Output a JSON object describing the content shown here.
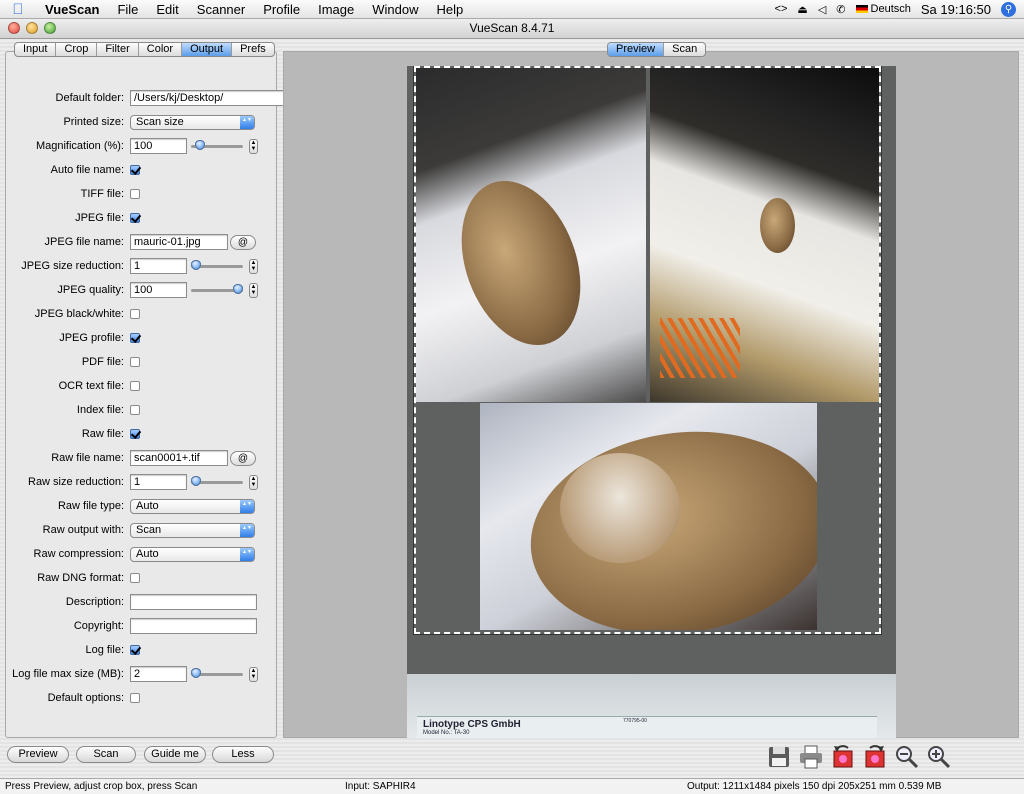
{
  "menubar": {
    "app": "VueScan",
    "items": [
      "File",
      "Edit",
      "Scanner",
      "Profile",
      "Image",
      "Window",
      "Help"
    ],
    "language": "Deutsch",
    "clock": "Sa 19:16:50",
    "status_icons": [
      "code-icon",
      "eject-icon",
      "volume-icon",
      "phone-icon"
    ]
  },
  "window": {
    "title": "VueScan 8.4.71"
  },
  "left_tabs": [
    {
      "label": "Input",
      "active": false
    },
    {
      "label": "Crop",
      "active": false
    },
    {
      "label": "Filter",
      "active": false
    },
    {
      "label": "Color",
      "active": false
    },
    {
      "label": "Output",
      "active": true
    },
    {
      "label": "Prefs",
      "active": false
    }
  ],
  "right_tabs": [
    {
      "label": "Preview",
      "active": true
    },
    {
      "label": "Scan",
      "active": false
    }
  ],
  "output": {
    "default_folder": {
      "label": "Default folder:",
      "value": "/Users/kj/Desktop/",
      "button": "@"
    },
    "printed_size": {
      "label": "Printed size:",
      "value": "Scan size"
    },
    "magnification": {
      "label": "Magnification (%):",
      "value": "100",
      "slider": 0.1
    },
    "auto_file_name": {
      "label": "Auto file name:",
      "checked": true
    },
    "tiff_file": {
      "label": "TIFF file:",
      "checked": false
    },
    "jpeg_file": {
      "label": "JPEG file:",
      "checked": true
    },
    "jpeg_file_name": {
      "label": "JPEG file name:",
      "value": "mauric-01.jpg",
      "button": "@"
    },
    "jpeg_size_reduction": {
      "label": "JPEG size reduction:",
      "value": "1",
      "slider": 0.0
    },
    "jpeg_quality": {
      "label": "JPEG quality:",
      "value": "100",
      "slider": 1.0
    },
    "jpeg_black_white": {
      "label": "JPEG black/white:",
      "checked": false
    },
    "jpeg_profile": {
      "label": "JPEG profile:",
      "checked": true
    },
    "pdf_file": {
      "label": "PDF file:",
      "checked": false
    },
    "ocr_text_file": {
      "label": "OCR text file:",
      "checked": false
    },
    "index_file": {
      "label": "Index file:",
      "checked": false
    },
    "raw_file": {
      "label": "Raw file:",
      "checked": true
    },
    "raw_file_name": {
      "label": "Raw file name:",
      "value": "scan0001+.tif",
      "button": "@"
    },
    "raw_size_reduction": {
      "label": "Raw size reduction:",
      "value": "1",
      "slider": 0.0
    },
    "raw_file_type": {
      "label": "Raw file type:",
      "value": "Auto"
    },
    "raw_output_with": {
      "label": "Raw output with:",
      "value": "Scan"
    },
    "raw_compression": {
      "label": "Raw compression:",
      "value": "Auto"
    },
    "raw_dng_format": {
      "label": "Raw DNG format:",
      "checked": false
    },
    "description": {
      "label": "Description:",
      "value": ""
    },
    "copyright": {
      "label": "Copyright:",
      "value": ""
    },
    "log_file": {
      "label": "Log file:",
      "checked": true
    },
    "log_file_max_size": {
      "label": "Log file max size (MB):",
      "value": "2",
      "slider": 0.0
    },
    "default_options": {
      "label": "Default options:",
      "checked": false
    }
  },
  "buttons": {
    "preview": "Preview",
    "scan": "Scan",
    "guide": "Guide me",
    "less": "Less"
  },
  "toolbar_icons": [
    "save-icon",
    "print-icon",
    "rotate-left-icon",
    "rotate-right-icon",
    "zoom-out-icon",
    "zoom-in-icon"
  ],
  "scanner_label": {
    "brand": "Linotype CPS GmbH",
    "model": "Model No.: TA-30",
    "code": "770795-00"
  },
  "status": {
    "left": "Press Preview, adjust crop box, press Scan",
    "input": "Input: SAPHIR4",
    "output": "Output: 1211x1484 pixels 150 dpi 205x251 mm 0.539 MB"
  },
  "colors": {
    "accent": "#3f86e8",
    "panel": "#e9e9e9",
    "preview_bg": "#b8b8b8"
  }
}
